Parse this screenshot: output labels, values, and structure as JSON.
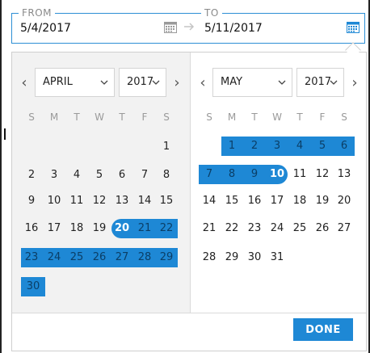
{
  "header": {
    "from_label": "FROM",
    "to_label": "TO",
    "from_value": "5/4/2017",
    "to_value": "5/11/2017"
  },
  "left_calendar": {
    "month": "APRIL",
    "year": "2017",
    "weekdays": [
      "S",
      "M",
      "T",
      "W",
      "T",
      "F",
      "S"
    ],
    "days": [
      "1",
      "2",
      "3",
      "4",
      "5",
      "6",
      "7",
      "8",
      "9",
      "10",
      "11",
      "12",
      "13",
      "14",
      "15",
      "16",
      "17",
      "18",
      "19",
      "20",
      "21",
      "22",
      "23",
      "24",
      "25",
      "26",
      "27",
      "28",
      "29",
      "30"
    ]
  },
  "right_calendar": {
    "month": "MAY",
    "year": "2017",
    "weekdays": [
      "S",
      "M",
      "T",
      "W",
      "T",
      "F",
      "S"
    ],
    "days": [
      "1",
      "2",
      "3",
      "4",
      "5",
      "6",
      "7",
      "8",
      "9",
      "10",
      "11",
      "12",
      "13",
      "14",
      "15",
      "16",
      "17",
      "18",
      "19",
      "20",
      "21",
      "22",
      "23",
      "24",
      "25",
      "26",
      "27",
      "28",
      "29",
      "30",
      "31"
    ]
  },
  "footer": {
    "done_label": "DONE"
  },
  "colors": {
    "accent": "#1e88d5",
    "selected_text": "#0b3e66",
    "left_bg": "#f2f2f2"
  },
  "icons": {
    "calendar": "calendar-icon",
    "arrow": "arrow-right-icon",
    "prev": "chevron-left-icon",
    "next": "chevron-right-icon",
    "dropdown": "chevron-down-icon"
  }
}
